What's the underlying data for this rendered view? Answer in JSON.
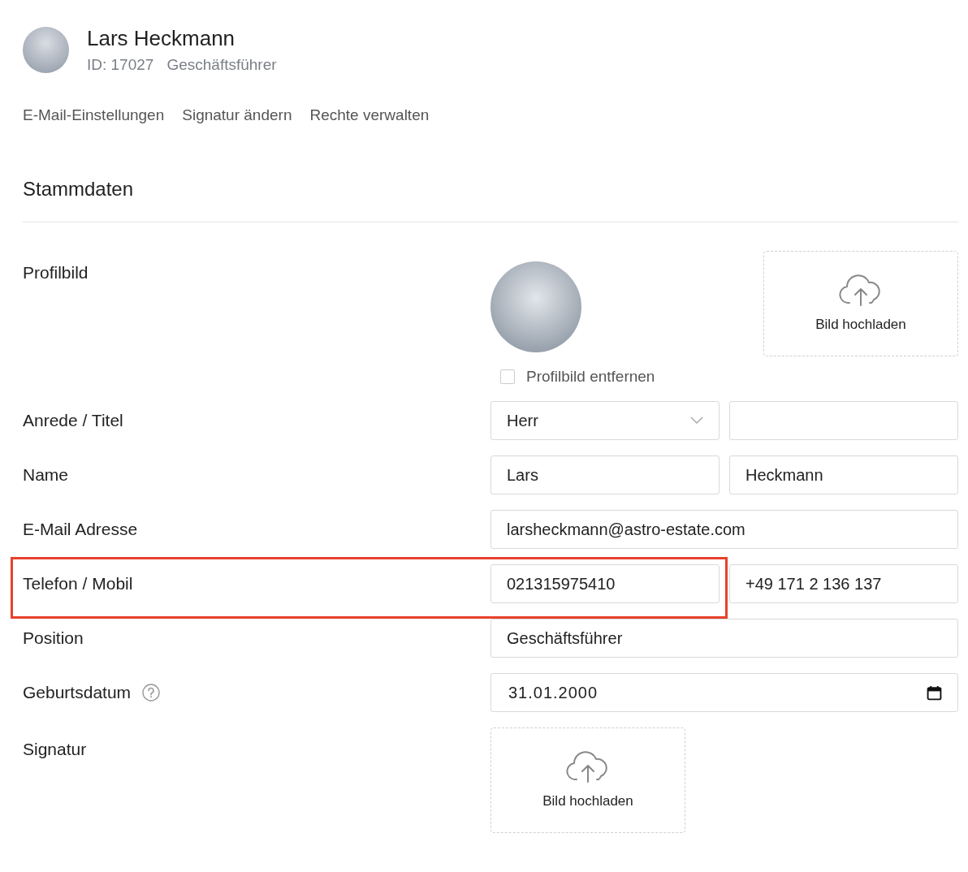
{
  "header": {
    "name": "Lars Heckmann",
    "id": "ID: 17027",
    "role": "Geschäftsführer"
  },
  "links": [
    "E-Mail-Einstellungen",
    "Signatur ändern",
    "Rechte verwalten"
  ],
  "section": {
    "title": "Stammdaten"
  },
  "rows": [
    {
      "kind": "photo",
      "label": "Profilbild",
      "upload": "Bild hochladen",
      "remove": {
        "label": "Profilbild entfernen",
        "checked": false
      },
      "highlighted": false
    },
    {
      "kind": "select-pair",
      "label": "Anrede / Titel",
      "values": [
        "Herr"
      ],
      "highlighted": false
    },
    {
      "kind": "pair",
      "label": "Name",
      "values": [
        "Lars",
        "Heckmann"
      ],
      "highlighted": false
    },
    {
      "kind": "single",
      "label": "E-Mail Adresse",
      "values": [
        "larsheckmann@astro-estate.com"
      ],
      "highlighted": false
    },
    {
      "kind": "pair",
      "label": "Telefon / Mobil",
      "values": [
        "021315975410",
        "+49 171 2 136 137"
      ],
      "highlighted": true
    },
    {
      "kind": "single",
      "label": "Position",
      "values": [
        "Geschäftsführer"
      ],
      "highlighted": false
    },
    {
      "kind": "date",
      "label": "Geburtsdatum",
      "help": true,
      "values": [
        "31.01.2000"
      ],
      "highlighted": false
    },
    {
      "kind": "upload",
      "label": "Signatur",
      "upload": "Bild hochladen",
      "highlighted": false
    }
  ]
}
